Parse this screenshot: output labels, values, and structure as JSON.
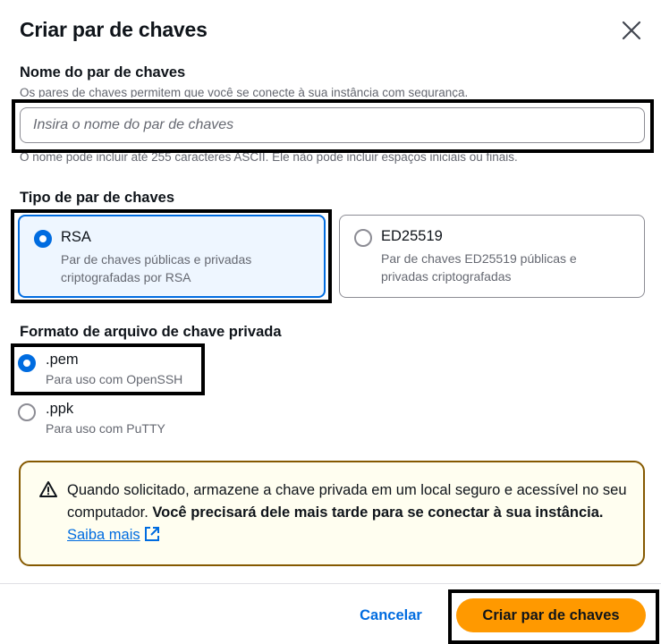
{
  "dialog": {
    "title": "Criar par de chaves",
    "close_icon": "close-icon"
  },
  "key_name": {
    "label": "Nome do par de chaves",
    "description": "Os pares de chaves permitem que você se conecte à sua instância com segurança.",
    "placeholder": "Insira o nome do par de chaves",
    "value": "",
    "hint": "O nome pode incluir até 255 caracteres ASCII. Ele não pode incluir espaços iniciais ou finais."
  },
  "key_type": {
    "label": "Tipo de par de chaves",
    "options": [
      {
        "name": "RSA",
        "description": "Par de chaves públicas e privadas criptografadas por RSA",
        "selected": true
      },
      {
        "name": "ED25519",
        "description": "Par de chaves ED25519 públicas e privadas criptografadas",
        "selected": false
      }
    ]
  },
  "file_format": {
    "label": "Formato de arquivo de chave privada",
    "options": [
      {
        "name": ".pem",
        "description": "Para uso com OpenSSH",
        "selected": true
      },
      {
        "name": ".ppk",
        "description": "Para uso com PuTTY",
        "selected": false
      }
    ]
  },
  "alert": {
    "icon": "warning-icon",
    "text_plain": "Quando solicitado, armazene a chave privada em um local seguro e acessível no seu computador. ",
    "text_bold": "Você precisará dele mais tarde para se conectar à sua instância.",
    "link_label": "Saiba mais",
    "link_icon": "external-link-icon"
  },
  "footer": {
    "cancel_label": "Cancelar",
    "submit_label": "Criar par de chaves"
  },
  "colors": {
    "accent": "#006ce0",
    "primary_button": "#ff9900",
    "selected_tile_bg": "#eef6ff",
    "alert_bg": "#fffef0",
    "alert_border": "#855900",
    "highlight_box": "#000000"
  }
}
